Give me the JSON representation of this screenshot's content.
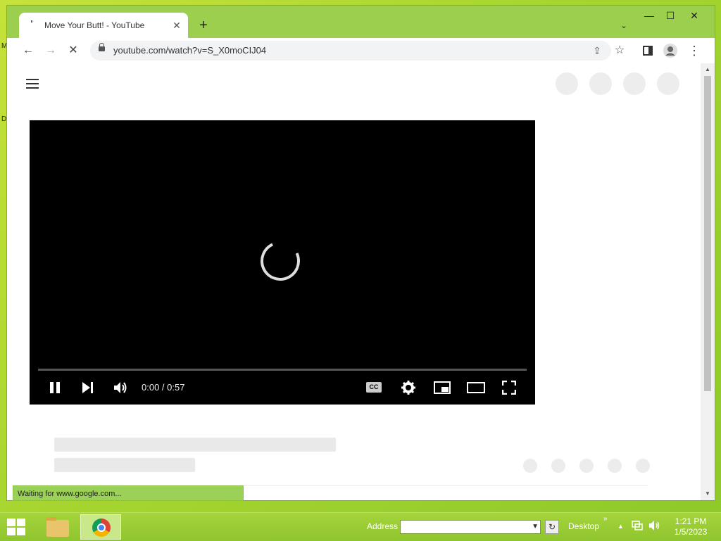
{
  "desktop": {
    "icon_labels": [
      "M",
      "D"
    ]
  },
  "browser": {
    "tab": {
      "title": "Move Your Butt! - YouTube",
      "close_glyph": "✕"
    },
    "new_tab_glyph": "+",
    "tab_search_glyph": "⌄",
    "window_controls": {
      "minimize": "—",
      "maximize": "☐",
      "close": "✕"
    },
    "toolbar": {
      "back_glyph": "←",
      "forward_glyph": "→",
      "stop_glyph": "✕",
      "url": "youtube.com/watch?v=S_X0moCIJ04",
      "share_glyph": "⇪",
      "bookmark_glyph": "☆",
      "menu_glyph": "⋮"
    },
    "status_text": "Waiting for www.google.com..."
  },
  "player": {
    "time_current": "0:00",
    "time_total": "0:57",
    "timecode": "0:00 / 0:57",
    "progress": 0,
    "cc_label": "CC"
  },
  "taskbar": {
    "address_label": "Address",
    "address_value": "",
    "desktop_label": "Desktop",
    "overflow_glyph": "»",
    "clock_time": "1:21 PM",
    "clock_date": "1/5/2023"
  },
  "colors": {
    "desktop_bg": "#a9d630",
    "window_frame": "#9ccf4e",
    "player_bg": "#000000",
    "placeholder": "#e9e9e9"
  }
}
